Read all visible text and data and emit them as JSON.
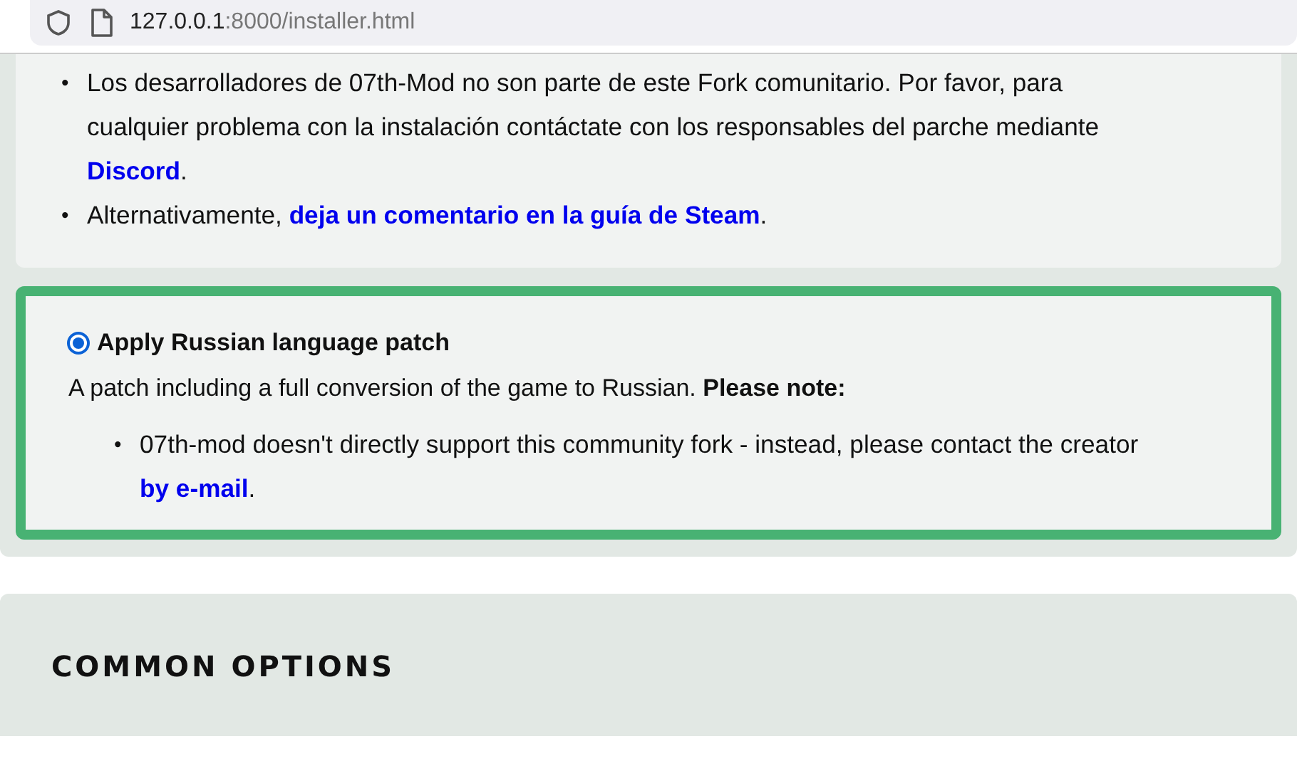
{
  "browser": {
    "url_host": "127.0.0.1",
    "url_rest": ":8000/installer.html"
  },
  "notice": {
    "items": [
      {
        "marker": "•",
        "segments": [
          {
            "kind": "text",
            "text": "Los desarrolladores de 07th-Mod no son parte de este Fork comunitario. Por favor, para cualquier problema con la instalación contáctate con los responsables del parche mediante "
          },
          {
            "kind": "link",
            "text": "Discord"
          },
          {
            "kind": "text",
            "text": "."
          }
        ]
      },
      {
        "marker": "•",
        "segments": [
          {
            "kind": "text",
            "text": "Alternativamente, "
          },
          {
            "kind": "link",
            "text": "deja un comentario en la guía de Steam"
          },
          {
            "kind": "text",
            "text": "."
          }
        ]
      }
    ]
  },
  "option": {
    "label": "Apply Russian language patch",
    "selected": true,
    "description": "A patch including a full conversion of the game to Russian. **Please note:**",
    "notes": [
      {
        "marker": "•",
        "segments": [
          {
            "kind": "text",
            "text": "07th-mod doesn't directly support this community fork - instead, please contact the creator "
          },
          {
            "kind": "link",
            "text": "by e-mail"
          },
          {
            "kind": "text",
            "text": "."
          }
        ]
      }
    ]
  },
  "section": {
    "title": "COMMON OPTIONS"
  }
}
